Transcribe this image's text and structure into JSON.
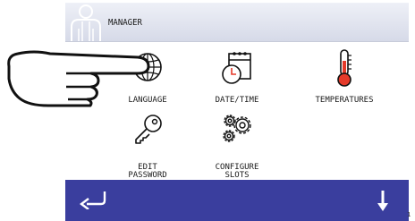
{
  "header": {
    "title": "MANAGER",
    "user_icon": "user-icon"
  },
  "menu": {
    "language": {
      "label": "LANGUAGE",
      "icon": "globe-icon"
    },
    "datetime": {
      "label": "DATE/TIME",
      "icon": "calendar-clock-icon"
    },
    "temperatures": {
      "label": "TEMPERATURES",
      "icon": "thermometer-icon"
    },
    "edit_password": {
      "label": "EDIT\nPASSWORD",
      "icon": "key-icon"
    },
    "configure_slots": {
      "label": "CONFIGURE\nSLOTS",
      "icon": "gears-icon"
    }
  },
  "footer": {
    "back_icon": "back-arrow-icon",
    "down_icon": "down-arrow-icon"
  },
  "page_indicator": "1",
  "colors": {
    "header_bg": "#d6dae8",
    "footer_bg": "#3a3e9e",
    "thermometer": "#e53a2a"
  }
}
